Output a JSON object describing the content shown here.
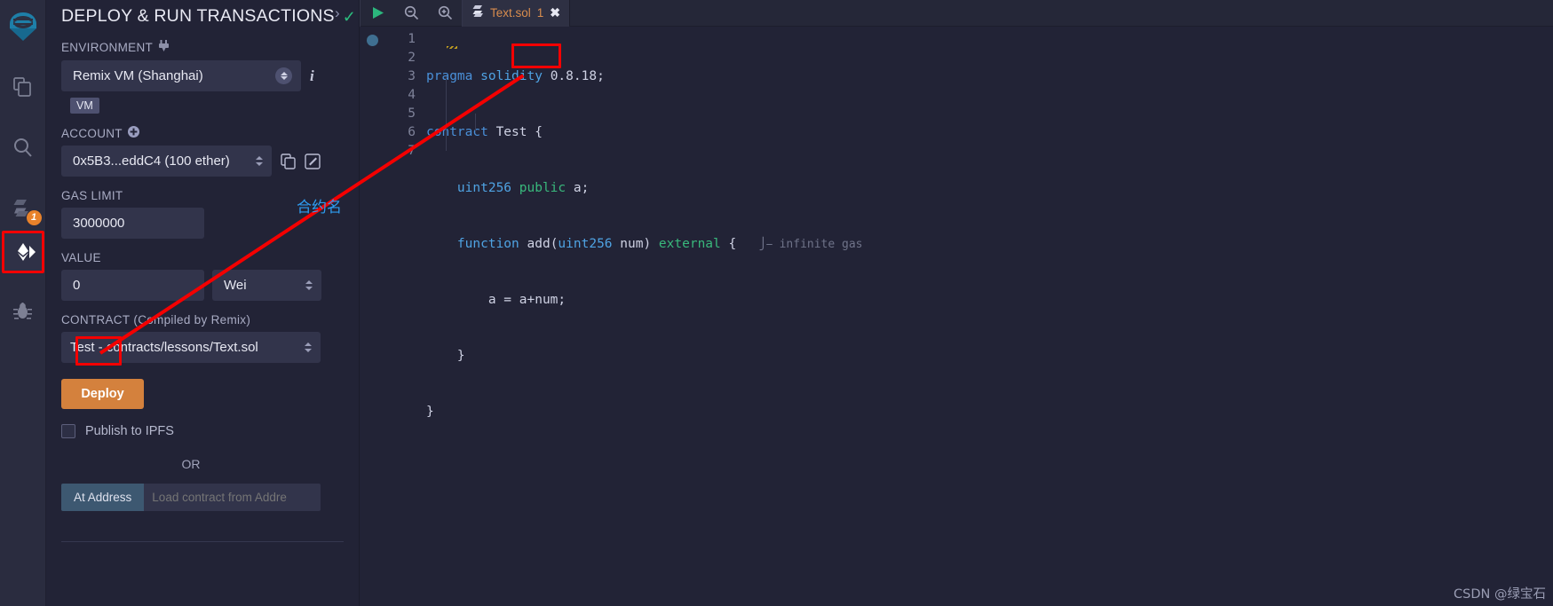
{
  "rail": {
    "logo_icon": "remix-logo-icon",
    "items": [
      {
        "name": "file-explorer-icon",
        "label": "File explorer",
        "badge": null,
        "selected": false
      },
      {
        "name": "search-icon",
        "label": "Search in files",
        "badge": null,
        "selected": false
      },
      {
        "name": "solidity-compiler-icon",
        "label": "Solidity compiler",
        "badge": "1",
        "selected": false
      },
      {
        "name": "deploy-run-icon",
        "label": "Deploy & run transactions",
        "badge": null,
        "selected": true
      },
      {
        "name": "debugger-icon",
        "label": "Debugger",
        "badge": null,
        "selected": false
      }
    ]
  },
  "panel": {
    "title": "DEPLOY & RUN TRANSACTIONS",
    "title_check_icon": "check-icon",
    "chevron_icon": "chevron-right-icon",
    "environment": {
      "label": "ENVIRONMENT",
      "plug_icon": "plug-icon",
      "value": "Remix VM (Shanghai)",
      "info_icon": "info-icon",
      "badge": "VM"
    },
    "account": {
      "label": "ACCOUNT",
      "add_icon": "plus-circle-icon",
      "value": "0x5B3...eddC4 (100 ether)",
      "copy_icon": "copy-icon",
      "edit_icon": "edit-icon"
    },
    "gas_limit": {
      "label": "GAS LIMIT",
      "value": "3000000"
    },
    "value": {
      "label": "VALUE",
      "value": "0",
      "unit": "Wei"
    },
    "contract": {
      "label": "CONTRACT",
      "label_suffix": "(Compiled by Remix)",
      "value": "Test - contracts/lessons/Text.sol"
    },
    "deploy_button": "Deploy",
    "publish_ipfs": "Publish to IPFS",
    "or": "OR",
    "at_address_button": "At Address",
    "at_address_placeholder": "Load contract from Addre"
  },
  "editor": {
    "run_icon": "run-play-icon",
    "zoom_out_icon": "zoom-out-icon",
    "zoom_in_icon": "zoom-in-icon",
    "tab": {
      "file_icon": "solidity-file-icon",
      "name": "Text.sol",
      "count": "1",
      "close_icon": "close-icon"
    },
    "breakpoint_icon": "breakpoint-dot-icon",
    "line_numbers": [
      "1",
      "2",
      "3",
      "4",
      "5",
      "6",
      "7"
    ],
    "code_lines": [
      "pragma solidity 0.8.18;",
      "contract Test {",
      "    uint256 public a;",
      "    function add(uint256 num) external {",
      "        a = a+num;",
      "    }",
      "}"
    ],
    "gas_hint": "infinite gas",
    "gas_hint_icon": "gas-pump-icon"
  },
  "annotation": {
    "note_cn": "合约名",
    "note_color": "#2e9cf0",
    "box_color": "#f40000",
    "arrow_color": "#f40000"
  },
  "watermark": "CSDN @绿宝石",
  "colors": {
    "panel_bg": "#222336",
    "rail_bg": "#2a2c3f",
    "input_bg": "#32344b",
    "deploy_orange": "#d4813d",
    "at_address_blue": "#3d5871",
    "tab_orange": "#d98d4e",
    "check_green": "#2bbd7e",
    "badge_orange": "#e8822b"
  }
}
